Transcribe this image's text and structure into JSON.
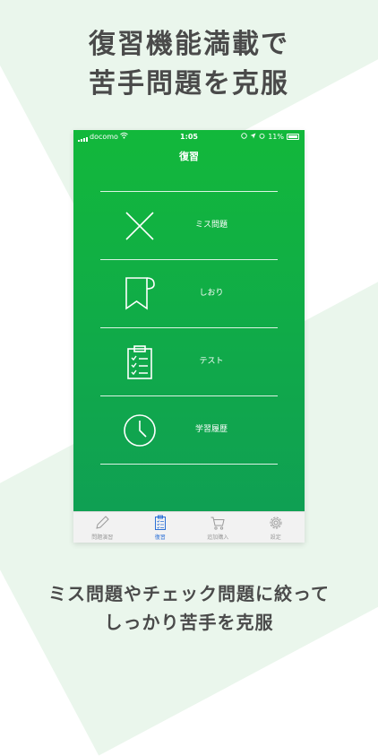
{
  "headline": {
    "line1": "復習機能満載で",
    "line2": "苦手問題を克服"
  },
  "footline": {
    "line1": "ミス問題やチェック問題に絞って",
    "line2": "しっかり苦手を克服"
  },
  "status_bar": {
    "carrier": "docomo",
    "time": "1:05",
    "battery": "11%"
  },
  "nav": {
    "title": "復習"
  },
  "menu": {
    "items": [
      {
        "label": "ミス問題",
        "icon": "cross-icon"
      },
      {
        "label": "しおり",
        "icon": "bookmark-icon"
      },
      {
        "label": "テスト",
        "icon": "clipboard-checklist-icon"
      },
      {
        "label": "学習履歴",
        "icon": "clock-icon"
      }
    ]
  },
  "tabs": [
    {
      "label": "問題演習",
      "icon": "pencil-icon",
      "active": false
    },
    {
      "label": "復習",
      "icon": "clipboard-icon",
      "active": true
    },
    {
      "label": "追加購入",
      "icon": "cart-icon",
      "active": false
    },
    {
      "label": "設定",
      "icon": "gear-icon",
      "active": false
    }
  ],
  "colors": {
    "primary_green": "#12b83b",
    "active_tab": "#2a6fd6",
    "headline_text": "#4a4a4a"
  }
}
